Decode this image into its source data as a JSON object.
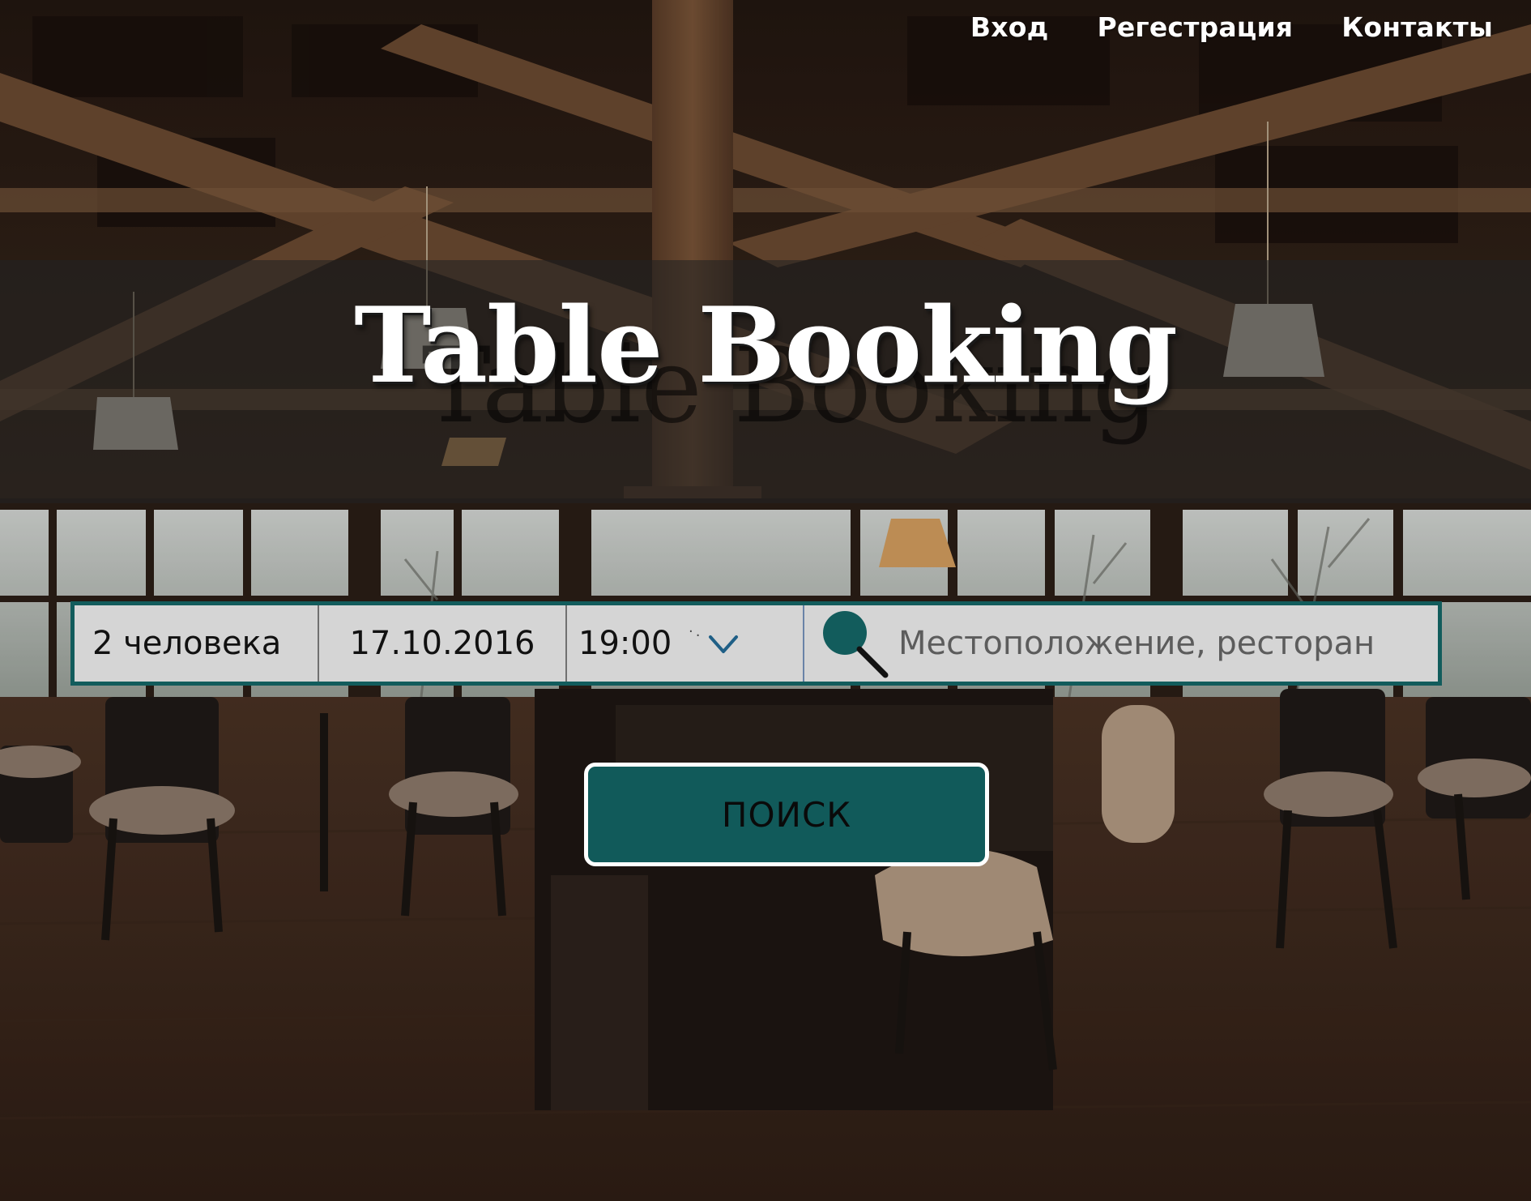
{
  "nav": {
    "login": "Вход",
    "register": "Регестрация",
    "contacts": "Контакты"
  },
  "hero": {
    "title": "Table Booking"
  },
  "search_form": {
    "people": "2 человека",
    "date": "17.10.2016",
    "time": "19:00",
    "location_placeholder": "Местоположение, ресторан",
    "location_value": ""
  },
  "search_button": {
    "label": "ПОИСК"
  },
  "icons": {
    "time_dropdown": "chevron-down-icon",
    "location_search": "search-icon"
  },
  "colors": {
    "accent": "#115a5a",
    "field_bg": "#d5d5d5",
    "title_band": "rgba(35,35,35,0.58)",
    "text_light": "#ffffff"
  }
}
